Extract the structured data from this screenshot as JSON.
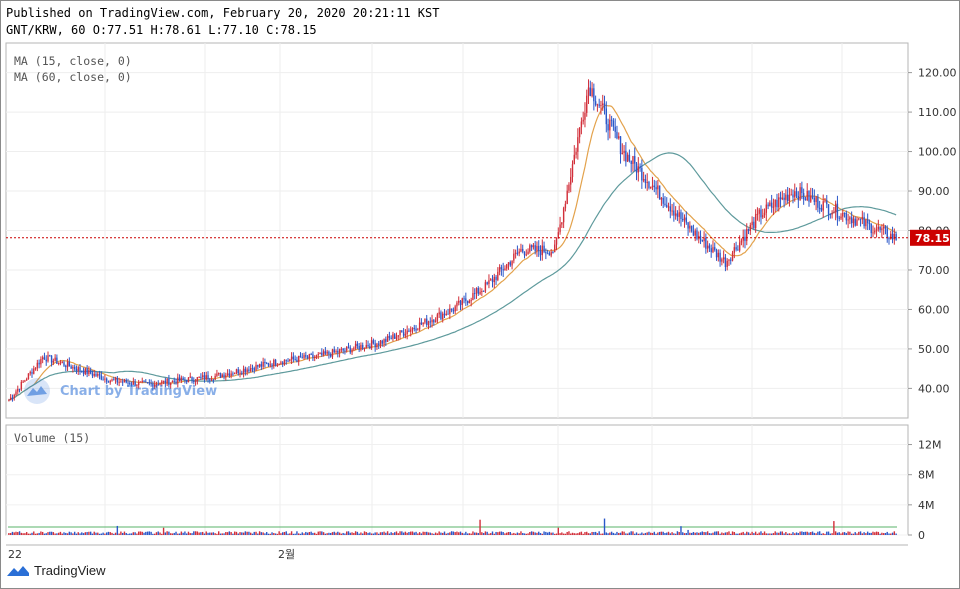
{
  "header": {
    "published": "Published on TradingView.com, February 20, 2020 20:21:11 KST",
    "ohlc": "GNT/KRW, 60 O:77.51 H:78.61 L:77.10 C:78.15"
  },
  "indicators": [
    "MA (15, close, 0)",
    "MA (60, close, 0)"
  ],
  "volume_label": "Volume (15)",
  "watermark": "Chart by TradingView",
  "footer_brand": "TradingView",
  "last_price_label": "78.15",
  "colors": {
    "up": "#d22f3a",
    "down": "#2a57c9",
    "ma_fast": "#e3a24c",
    "ma_slow": "#5e9a9c",
    "vol_ma": "#58b36a",
    "last_price": "#cc0000"
  },
  "chart_data": {
    "type": "candlestick",
    "price_axis": {
      "ticks": [
        40,
        50,
        60,
        70,
        80,
        90,
        100,
        110,
        120
      ],
      "labels": [
        "40.00",
        "50.00",
        "60.00",
        "70.00",
        "80.00",
        "90.00",
        "100.00",
        "110.00",
        "120.00"
      ],
      "range": [
        32.5,
        127.5
      ]
    },
    "volume_axis": {
      "ticks": [
        0,
        4,
        8,
        12
      ],
      "labels": [
        "0",
        "4M",
        "8M",
        "12M"
      ],
      "range": [
        0,
        13
      ]
    },
    "x_ticks": [
      "22",
      "2월"
    ],
    "last_price": 78.15,
    "series_approx": [
      37,
      48,
      45,
      42,
      41,
      42,
      43,
      45,
      47,
      48,
      50,
      52,
      56,
      60,
      66,
      75,
      75,
      117,
      100,
      90,
      80,
      72,
      84,
      90,
      86,
      82,
      78
    ]
  }
}
